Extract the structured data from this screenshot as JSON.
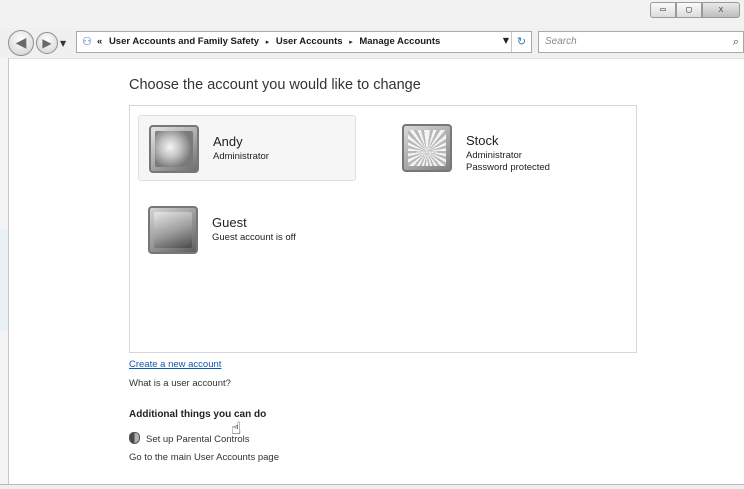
{
  "window": {
    "controls": {
      "minimize": "▭",
      "maximize": "▢",
      "close": "x"
    }
  },
  "navigation": {
    "back_icon": "back-arrow-icon",
    "forward_icon": "forward-arrow-icon",
    "overflow": "«",
    "breadcrumb": [
      "User Accounts and Family Safety",
      "User Accounts",
      "Manage Accounts"
    ],
    "separator": "▸",
    "search_placeholder": "Search"
  },
  "main": {
    "heading": "Choose the account you would like to change",
    "accounts": [
      {
        "name": "Andy",
        "line1": "Administrator",
        "line2": "",
        "selected": true
      },
      {
        "name": "Stock",
        "line1": "Administrator",
        "line2": "Password protected",
        "selected": false
      },
      {
        "name": "Guest",
        "line1": "Guest account is off",
        "line2": "",
        "selected": false
      }
    ],
    "create_link": "Create a new account",
    "what_link": "What is a user account?",
    "additional_title": "Additional things you can do",
    "parental_controls": "Set up Parental Controls",
    "main_page_link": "Go to the main User Accounts page"
  },
  "colors": {
    "link": "#0b58b5",
    "watermark": "#e9f1f4"
  }
}
